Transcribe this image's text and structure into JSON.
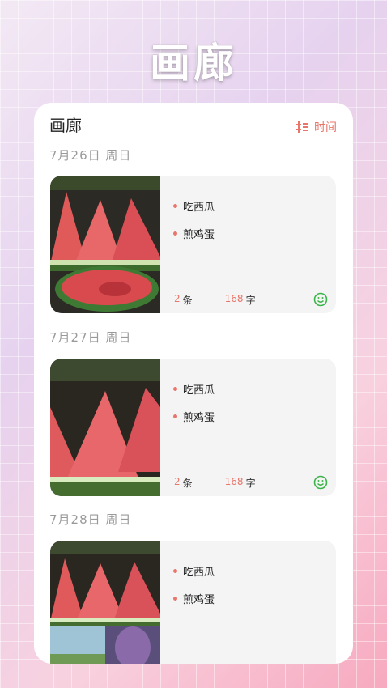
{
  "hero": {
    "title": "画廊"
  },
  "header": {
    "title": "画廊",
    "sort_label": "时间"
  },
  "colors": {
    "accent": "#e8766a",
    "mood": "#3bb54a"
  },
  "entries": [
    {
      "date": "7月26日 周日",
      "items": [
        "吃西瓜",
        "煎鸡蛋"
      ],
      "count": "2",
      "count_unit": "条",
      "chars": "168",
      "chars_unit": "字",
      "mood_icon": "smile-icon"
    },
    {
      "date": "7月27日 周日",
      "items": [
        "吃西瓜",
        "煎鸡蛋"
      ],
      "count": "2",
      "count_unit": "条",
      "chars": "168",
      "chars_unit": "字",
      "mood_icon": "smile-icon"
    },
    {
      "date": "7月28日 周日",
      "items": [
        "吃西瓜",
        "煎鸡蛋"
      ],
      "count": "",
      "count_unit": "",
      "chars": "",
      "chars_unit": "",
      "mood_icon": ""
    }
  ]
}
